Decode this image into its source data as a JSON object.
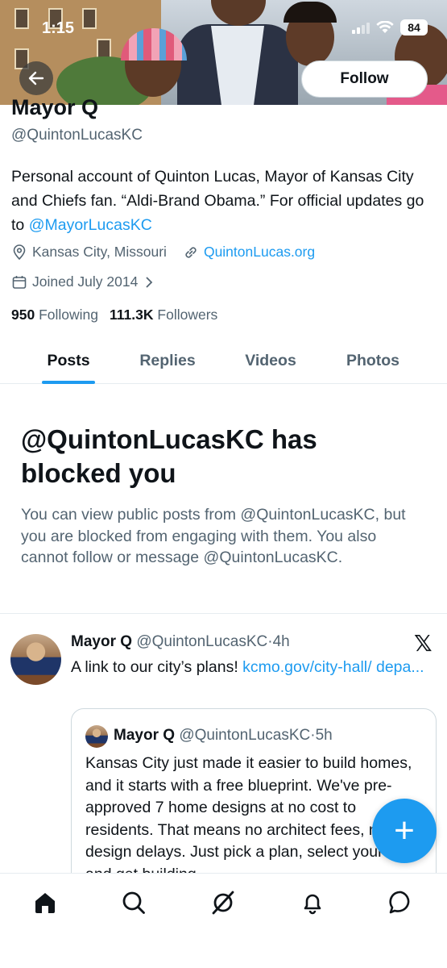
{
  "status_bar": {
    "time": "1:15",
    "battery": "84"
  },
  "header": {
    "follow_label": "Follow"
  },
  "profile": {
    "display_name": "Mayor Q",
    "handle": "@QuintonLucasKC",
    "bio_text": "Personal account of Quinton Lucas, Mayor of Kansas City and Chiefs fan. “Aldi-Brand Obama.” For official updates go to ",
    "bio_link": "@MayorLucasKC",
    "location": "Kansas City, Missouri",
    "website": "QuintonLucas.org",
    "joined": "Joined July 2014",
    "following_count": "950",
    "following_label": "Following",
    "followers_count": "111.3K",
    "followers_label": "Followers"
  },
  "tabs": [
    {
      "label": "Posts",
      "active": true
    },
    {
      "label": "Replies",
      "active": false
    },
    {
      "label": "Videos",
      "active": false
    },
    {
      "label": "Photos",
      "active": false
    }
  ],
  "blocked": {
    "title": "@QuintonLucasKC has blocked you",
    "description": "You can view public posts from @QuintonLucasKC, but you are blocked from engaging with them. You also cannot follow or message @QuintonLucasKC."
  },
  "tweet": {
    "author_name": "Mayor Q",
    "author_handle": "@QuintonLucasKC",
    "time": "4h",
    "text": "A link to our city’s plans! ",
    "link": "kcmo.gov/city-hall/ depa...",
    "quote": {
      "author_name": "Mayor Q",
      "author_handle": "@QuintonLucasKC",
      "time": "5h",
      "text": "Kansas City just made it easier to build homes, and it starts with a free blueprint. We've pre-approved 7 home designs at no cost to residents. That means no architect fees, no design delays. Just pick a plan, select your lot, and get building."
    }
  },
  "fab": {
    "label": "+"
  },
  "nav_icons": [
    "home-icon",
    "search-icon",
    "grok-icon",
    "notifications-icon",
    "messages-icon"
  ],
  "colors": {
    "accent": "#1d9bf0",
    "text": "#0f1419",
    "secondary": "#536471",
    "border": "#cfd9de"
  }
}
